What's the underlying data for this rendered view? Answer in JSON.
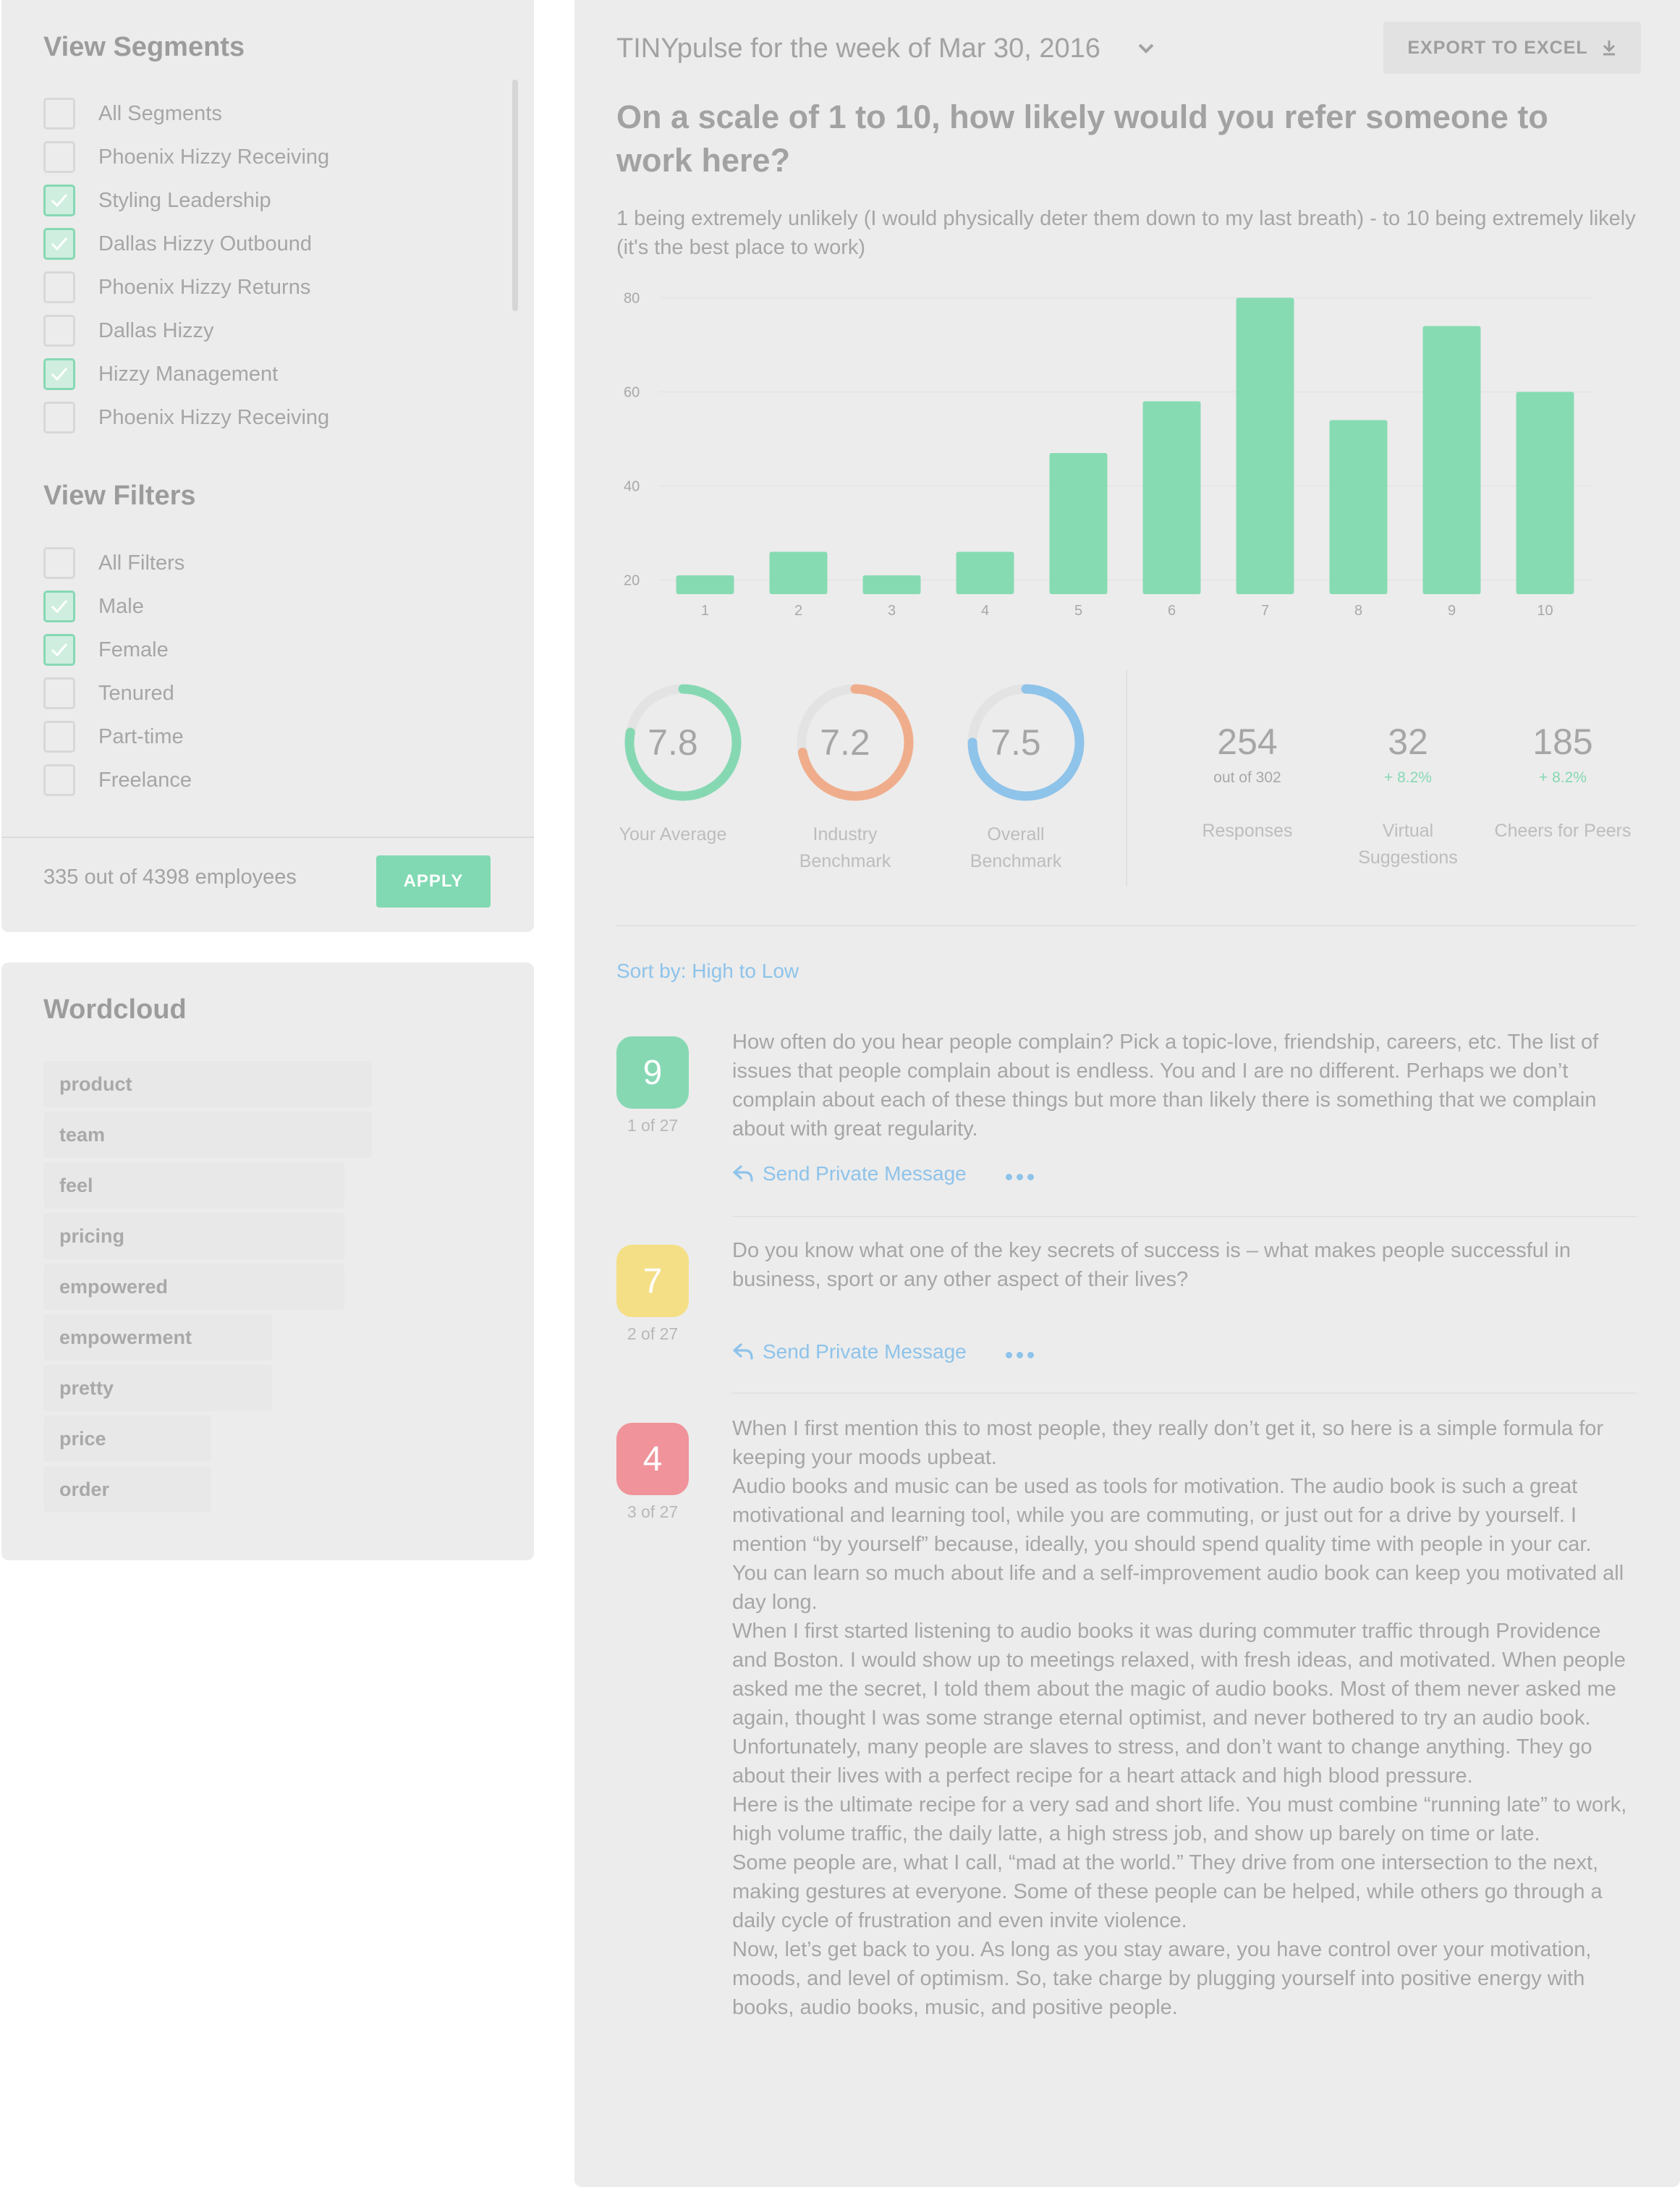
{
  "segments": {
    "title": "View Segments",
    "items": [
      {
        "label": "All Segments",
        "checked": false
      },
      {
        "label": "Phoenix Hizzy Receiving",
        "checked": false
      },
      {
        "label": "Styling Leadership",
        "checked": true
      },
      {
        "label": "Dallas Hizzy Outbound",
        "checked": true
      },
      {
        "label": "Phoenix Hizzy Returns",
        "checked": false
      },
      {
        "label": "Dallas Hizzy",
        "checked": false
      },
      {
        "label": "Hizzy Management",
        "checked": true
      },
      {
        "label": "Phoenix Hizzy Receiving",
        "checked": false
      }
    ]
  },
  "filters": {
    "title": "View Filters",
    "items": [
      {
        "label": "All Filters",
        "checked": false
      },
      {
        "label": "Male",
        "checked": true
      },
      {
        "label": "Female",
        "checked": true
      },
      {
        "label": "Tenured",
        "checked": false
      },
      {
        "label": "Part-time",
        "checked": false
      },
      {
        "label": "Freelance",
        "checked": false
      }
    ],
    "employee_count": "335 out of 4398 employees",
    "apply_label": "APPLY"
  },
  "wordcloud": {
    "title": "Wordcloud",
    "words": [
      "product",
      "team",
      "feel",
      "pricing",
      "empowered",
      "empowerment",
      "pretty",
      "price",
      "order"
    ]
  },
  "header": {
    "week_title": "TINYpulse for the week of Mar 30, 2016",
    "export_label": "EXPORT TO EXCEL"
  },
  "question": {
    "text": "On a scale of 1 to 10, how likely would you refer someone to work here?",
    "subtext": "1 being extremely unlikely (I would physically deter them down to my last breath) - to 10 being extremely likely (it's the best place to work)"
  },
  "chart_data": {
    "type": "bar",
    "categories": [
      "1",
      "2",
      "3",
      "4",
      "5",
      "6",
      "7",
      "8",
      "9",
      "10"
    ],
    "values": [
      21,
      26,
      21,
      26,
      47,
      58,
      80,
      54,
      74,
      60
    ],
    "yticks": [
      20,
      40,
      60,
      80
    ],
    "ylim": [
      17,
      81
    ],
    "xlabel": "",
    "ylabel": "",
    "color": "#86dbb3"
  },
  "scores": [
    {
      "value": "7.8",
      "score": 7.8,
      "label": "Your Average",
      "color": "#86d8b3"
    },
    {
      "value": "7.2",
      "score": 7.2,
      "label": "Industry Benchmark",
      "color": "#f0ad8c"
    },
    {
      "value": "7.5",
      "score": 7.5,
      "label": "Overall Benchmark",
      "color": "#8ec3ea"
    }
  ],
  "stats": [
    {
      "value": "254",
      "sub": "out of 302",
      "label": "Responses"
    },
    {
      "value": "32",
      "sub": "+ 8.2%",
      "label": "Virtual Suggestions"
    },
    {
      "value": "185",
      "sub": "+ 8.2%",
      "label": "Cheers for Peers"
    }
  ],
  "sort_label": "Sort by: High to Low",
  "responses": [
    {
      "score": "9",
      "rank": "1 of 27",
      "color": "#86d8b3",
      "paragraphs": [
        "How often do you hear people complain? Pick a topic-love, friendship, careers, etc. The list of issues that people complain about is endless. You and I are no different. Perhaps we don’t complain about each of these things but more than likely there is something that we complain about with great regularity."
      ],
      "action": "Send Private Message"
    },
    {
      "score": "7",
      "rank": "2 of 27",
      "color": "#f4df86",
      "paragraphs": [
        "Do you know what one of the key secrets of success is – what makes people successful in business, sport or any other aspect of their lives?"
      ],
      "action": "Send Private Message"
    },
    {
      "score": "4",
      "rank": "3 of 27",
      "color": "#f0939a",
      "paragraphs": [
        "When I first mention this to most people, they really don’t get it, so here is a simple formula for keeping your moods upbeat.",
        "Audio books and music can be used as tools for motivation. The audio book is such a great motivational and learning tool, while you are commuting, or just out for a drive by yourself. I mention “by yourself” because, ideally, you should spend quality time with people in your car.",
        "You can learn so much about life and a self-improvement audio book can keep you motivated all day long.",
        "When I first started listening to audio books it was during commuter traffic through Providence and Boston. I would show up to meetings relaxed, with fresh ideas, and motivated. When people asked me the secret, I told them about the magic of audio books. Most of them never asked me again, thought I was some strange eternal optimist, and never bothered to try an audio book.",
        "Unfortunately, many people are slaves to stress, and don’t want to change anything. They go about their lives with a perfect recipe for a heart attack and high blood pressure.",
        "Here is the ultimate recipe for a very sad and short life. You must combine “running late” to work, high volume traffic, the daily latte, a high stress job, and show up barely on time or late.",
        "Some people are, what I call, “mad at the world.” They drive from one intersection to the next, making gestures at everyone. Some of these people can be helped, while others go through a daily cycle of frustration and even invite violence.",
        "Now, let’s get back to you. As long as you stay aware, you have control over your motivation, moods, and level of optimism. So, take charge by plugging yourself into positive energy with books, audio books, music, and positive people."
      ]
    }
  ]
}
